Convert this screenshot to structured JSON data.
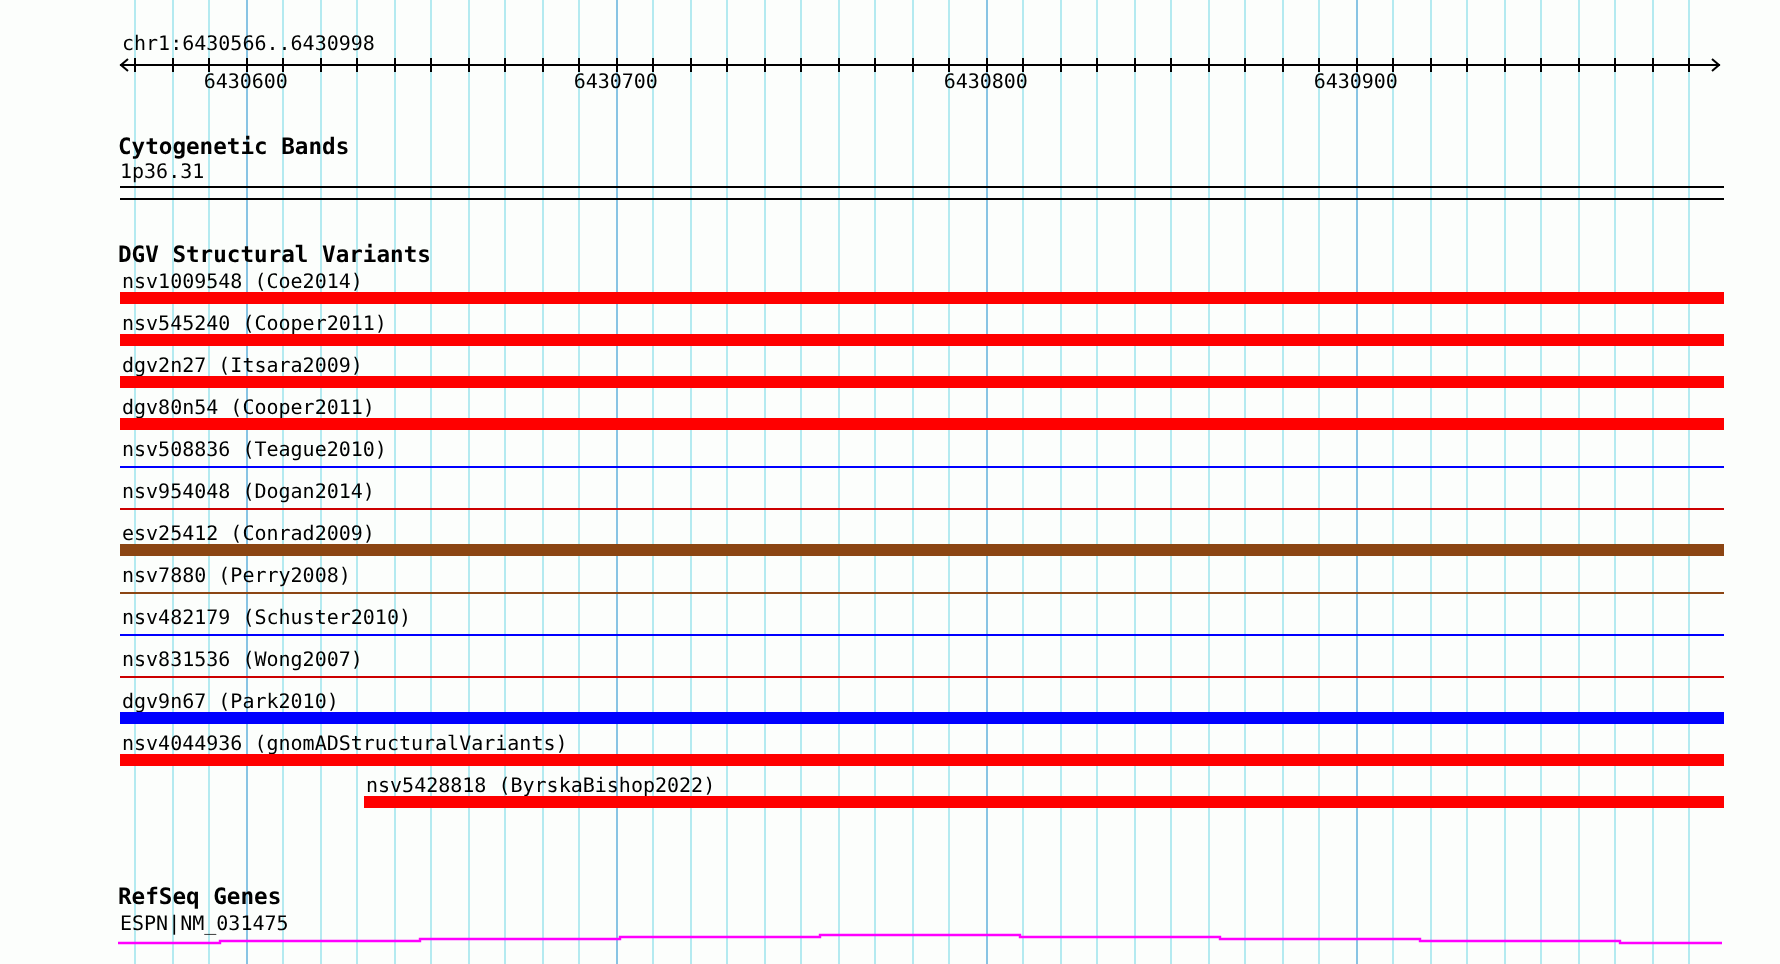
{
  "position": "chr1:6430566..6430998",
  "ruler": {
    "labels": [
      "6430600",
      "6430700",
      "6430800",
      "6430900"
    ]
  },
  "cytogenetic_bands": {
    "title": "Cytogenetic Bands",
    "band": "1p36.31"
  },
  "dgv": {
    "title": "DGV Structural Variants",
    "variants": [
      {
        "label": "nsv1009548 (Coe2014)",
        "kind": "thick",
        "color": "#ff0000",
        "indented": false
      },
      {
        "label": "nsv545240 (Cooper2011)",
        "kind": "thick",
        "color": "#ff0000",
        "indented": false
      },
      {
        "label": "dgv2n27 (Itsara2009)",
        "kind": "thick",
        "color": "#ff0000",
        "indented": false
      },
      {
        "label": "dgv80n54 (Cooper2011)",
        "kind": "thick",
        "color": "#ff0000",
        "indented": false
      },
      {
        "label": "nsv508836 (Teague2010)",
        "kind": "thin",
        "color": "#0000ff",
        "indented": false
      },
      {
        "label": "nsv954048 (Dogan2014)",
        "kind": "thin",
        "color": "#cc0000",
        "indented": false
      },
      {
        "label": "esv25412 (Conrad2009)",
        "kind": "thick",
        "color": "#8b4513",
        "indented": false
      },
      {
        "label": "nsv7880 (Perry2008)",
        "kind": "thin",
        "color": "#8b4513",
        "indented": false
      },
      {
        "label": "nsv482179 (Schuster2010)",
        "kind": "thin",
        "color": "#0000ff",
        "indented": false
      },
      {
        "label": "nsv831536 (Wong2007)",
        "kind": "thin",
        "color": "#cc0000",
        "indented": false
      },
      {
        "label": "dgv9n67 (Park2010)",
        "kind": "thick",
        "color": "#0000ff",
        "indented": false
      },
      {
        "label": "nsv4044936 (gnomADStructuralVariants)",
        "kind": "thick",
        "color": "#ff0000",
        "indented": false
      },
      {
        "label": "nsv5428818 (ByrskaBishop2022)",
        "kind": "thick",
        "color": "#ff0000",
        "indented": true
      }
    ]
  },
  "refseq": {
    "title": "RefSeq Genes",
    "gene": "ESPN|NM_031475"
  }
}
